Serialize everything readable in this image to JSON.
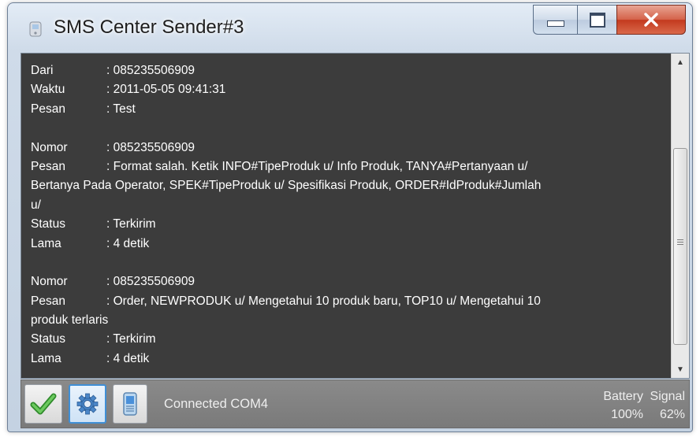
{
  "window": {
    "title": "SMS Center Sender#3",
    "icon": "sms-app-icon"
  },
  "messages": [
    {
      "rows": [
        {
          "label": "Dari",
          "value": ": 085235506909"
        },
        {
          "label": "Waktu",
          "value": ": 2011-05-05 09:41:31"
        },
        {
          "label": "Pesan",
          "value": ": Test"
        }
      ]
    },
    {
      "rows": [
        {
          "label": "Nomor",
          "value": ": 085235506909"
        },
        {
          "label": "Pesan",
          "value": ": Format salah. Ketik INFO#TipeProduk u/ Info Produk, TANYA#Pertanyaan u/"
        },
        {
          "label": "",
          "value": "Bertanya Pada Operator, SPEK#TipeProduk u/ Spesifikasi Produk, ORDER#IdProduk#Jumlah"
        },
        {
          "label": "",
          "value": "u/"
        },
        {
          "label": "Status",
          "value": ": Terkirim"
        },
        {
          "label": "Lama",
          "value": ": 4 detik"
        }
      ]
    },
    {
      "rows": [
        {
          "label": "Nomor",
          "value": ": 085235506909"
        },
        {
          "label": "Pesan",
          "value": ": Order, NEWPRODUK u/ Mengetahui 10 produk baru, TOP10 u/ Mengetahui 10"
        },
        {
          "label": "",
          "value": "produk terlaris"
        },
        {
          "label": "Status",
          "value": ": Terkirim"
        },
        {
          "label": "Lama",
          "value": ": 4 detik"
        }
      ]
    }
  ],
  "scrollbar": {
    "up_glyph": "▲",
    "down_glyph": "▼",
    "icons": [
      "scroll-up-arrow-icon",
      "scroll-down-arrow-icon",
      "scroll-grip-icon"
    ]
  },
  "statusbar": {
    "connection": "Connected COM4",
    "battery_label": "Battery",
    "battery_value": "100%",
    "signal_label": "Signal",
    "signal_value": "62%",
    "icons": [
      "checkmark-icon",
      "gear-icon",
      "phone-icon"
    ],
    "colors": {
      "check": "#3fa63a",
      "gear": "#3c7fc4"
    }
  }
}
